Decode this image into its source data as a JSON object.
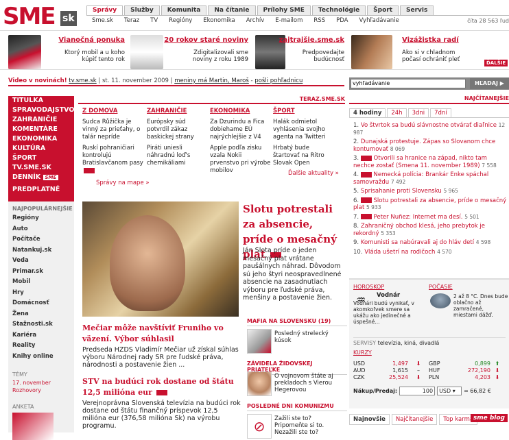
{
  "logo": {
    "brand": "SME",
    "suffix": "sk"
  },
  "topnav": {
    "tabs": [
      "Správy",
      "Služby",
      "Komunita",
      "Na čítanie",
      "Prílohy SME",
      "Technológie",
      "Šport",
      "Servis"
    ],
    "subnav": [
      "Sme.sk",
      "Teraz",
      "TV",
      "Regióny",
      "Ekonomika",
      "Archív",
      "E-mailom",
      "RSS",
      "PDA",
      "Vyhľadávanie"
    ],
    "readers": "číta 28 563 ľud"
  },
  "promo": [
    {
      "title": "Vianočná ponuka",
      "desc": "Ktorý mobil a u koho kúpiť tento rok"
    },
    {
      "title": "20 rokov staré noviny",
      "desc": "Zdigitalizovali sme noviny z roku 1989"
    },
    {
      "title": "zajtrajšie.sme.sk",
      "desc": "Predpovedajte budúcnosť"
    },
    {
      "title": "Vizážistka radí",
      "desc": "Ako si v chladnom počasí ochrániť pleť",
      "more": "ĎALŠIE"
    }
  ],
  "videobar": {
    "label": "Video v novinách!",
    "link": "tv.sme.sk",
    "date": "st. 11. november 2009",
    "names": "meniny má Martin, Maroš",
    "mail": "pošli pohľadnicu"
  },
  "search": {
    "placeholder": "vyhľadávanie",
    "button": "HĽADAJ"
  },
  "leftnav": {
    "items": [
      "TITULKA",
      "SPRAVODAJSTVO",
      "ZAHRANIČIE",
      "KOMENTÁRE",
      "EKONOMIKA",
      "KULTÚRA",
      "ŠPORT",
      "TV.SME.SK",
      "DENNÍK",
      "PREDPLATNÉ"
    ],
    "popular_header": "NAJPOPULÁRNEJŠIE",
    "popular": [
      "Regióny",
      "Auto",
      "Počítače",
      "Natankuj.sk",
      "Veda",
      "Primar.sk",
      "Mobil",
      "Hry",
      "Domácnosť",
      "Žena",
      "Stažnosti.sk",
      "Kariéra",
      "Reality",
      "Knihy online"
    ],
    "topics_header": "TÉMY",
    "topics": [
      "17. november",
      "Rozhovory"
    ],
    "poll_header": "ANKETA"
  },
  "teraz": "TERAZ.SME.SK",
  "columns": [
    {
      "head": "Z DOMOVA",
      "items": [
        "Sudca Růžička je vinný za prieťahy, o talár nepríde",
        "Ruskí pohraničiari kontrolujú Bratislavčanom pasy"
      ]
    },
    {
      "head": "ZAHRANIČIE",
      "items": [
        "Európsky súd potvrdil zákaz baskickej strany",
        "Piráti uniesli náhradnú loď's chemikáliami"
      ]
    },
    {
      "head": "EKONOMIKA",
      "items": [
        "Za Dzurindu a Fica dobiehame EÚ najrýchlejšie z V4",
        "Apple podľa zisku vzala Nokii prvenstvo pri výrobe mobilov"
      ]
    },
    {
      "head": "ŠPORT",
      "items": [
        "Halák odmietol vyhlásenia svojho agenta na Twitteri",
        "Hrbatý bude štartovať na Ritro Slovak Open"
      ]
    }
  ],
  "more": {
    "map": "Správy na mape »",
    "news": "Ďalšie aktuality »"
  },
  "lead": {
    "title": "Slotu potrestali za absencie, príde o mesačný plat",
    "text": "Ján Slota príde o jeden mesačný plat vrátane paušálnych náhrad. Dôvodom sú jeho štyri neospravedlnené absencie na zasadnutiach výboru pre ľudské práva, menšiny a postavenie žien."
  },
  "story2": {
    "title": "Mečiar môže navštíviť Fruniho vo väzení. Výbor súhlasil",
    "text": "Predseda HZDS Vladimír Mečiar už získal súhlas výboru Národnej rady SR pre ľudské práva, národnosti a postavenie žien ..."
  },
  "story3": {
    "title": "STV na budúci rok dostane od štátu 12,5 milióna eur",
    "text": "Verejnoprávna Slovenská televízia na budúci rok dostane od štátu finančný príspevok 12,5 milióna eur (376,58 milióna Sk) na výrobu programu."
  },
  "side": [
    {
      "head": "MAFIA NA SLOVENSKU (19)",
      "text": "Posledný strelecký kúsok"
    },
    {
      "head": "ZÁVIDELA ŽIDOVSKEJ PRIATEĽKE",
      "text": "O vojnovom štáte aj prekladoch s Vierou Hegerovou"
    },
    {
      "head": "POSLEDNÉ DNI KOMUNIZMU",
      "text": "Zažili ste to? Pripomeňte si to. Nezažili ste to?"
    }
  ],
  "najcitanejsie": {
    "header": "NAJČÍTANEJŠIE",
    "tabs": [
      "4 hodiny",
      "24h",
      "3dni",
      "7dní"
    ],
    "items": [
      {
        "n": "1.",
        "t": "Vo štvrtok sa budú slávnostne otvárať diaľnice",
        "c": "12 987"
      },
      {
        "n": "2.",
        "t": "Dunajská protestuje. Zápas so Slovanom chce kontumovať",
        "c": "8 069"
      },
      {
        "n": "3.",
        "t": "Otvorili sa hranice na západ, nikto tam nechce zostať (Smena 11. november 1989)",
        "c": "7 558"
      },
      {
        "n": "4.",
        "t": "Nemecká polícia: Brankár Enke spáchal samovraždu",
        "c": "7 492"
      },
      {
        "n": "5.",
        "t": "Sprisahanie proti Slovensku",
        "c": "5 965"
      },
      {
        "n": "6.",
        "t": "Slotu potrestali za absencie, príde o mesačný plat",
        "c": "5 933"
      },
      {
        "n": "7.",
        "t": "Peter Nuñez: Internet ma desí.",
        "c": "5 501"
      },
      {
        "n": "8.",
        "t": "Zahraničný obchod klesá, jeho prebytok je rekordný",
        "c": "5 353"
      },
      {
        "n": "9.",
        "t": "Komunisti sa nabúravali aj do hláv detí",
        "c": "4 598"
      },
      {
        "n": "10.",
        "t": "Vláda ušetrí na rodičoch",
        "c": "4 570"
      }
    ]
  },
  "info": {
    "horoskop": "HOROSKOP",
    "znamenie": "Vodnár",
    "horo_text": "Vodnári budú vynikať, v akomkoľvek smere sa ukážu ako jedinečné a úspešné...",
    "pocasie": "POČASIE",
    "pocasie_text": "2 až 8 °C. Dnes bude oblačno až zamračené, miestami dážď.",
    "servisy_label": "SERVISY",
    "servisy": "televízia, kiná, divadlá",
    "kurzy": "KURZY",
    "rates": [
      {
        "cur": "USD",
        "val": "1,497"
      },
      {
        "cur": "GBP",
        "val": "0,899"
      },
      {
        "cur": "AUD",
        "val": "1,615"
      },
      {
        "cur": "HUF",
        "val": "272,190"
      },
      {
        "cur": "CZK",
        "val": "25,524"
      },
      {
        "cur": "PLN",
        "val": "4,203"
      }
    ],
    "converter_label": "Nákup/Predaj:",
    "amount": "100",
    "currency": "USD",
    "result": "= 66,82 €"
  },
  "bottomtabs": [
    "Najnovšie",
    "Najčítanejšie",
    "Top karma"
  ],
  "blog": "sme blog"
}
